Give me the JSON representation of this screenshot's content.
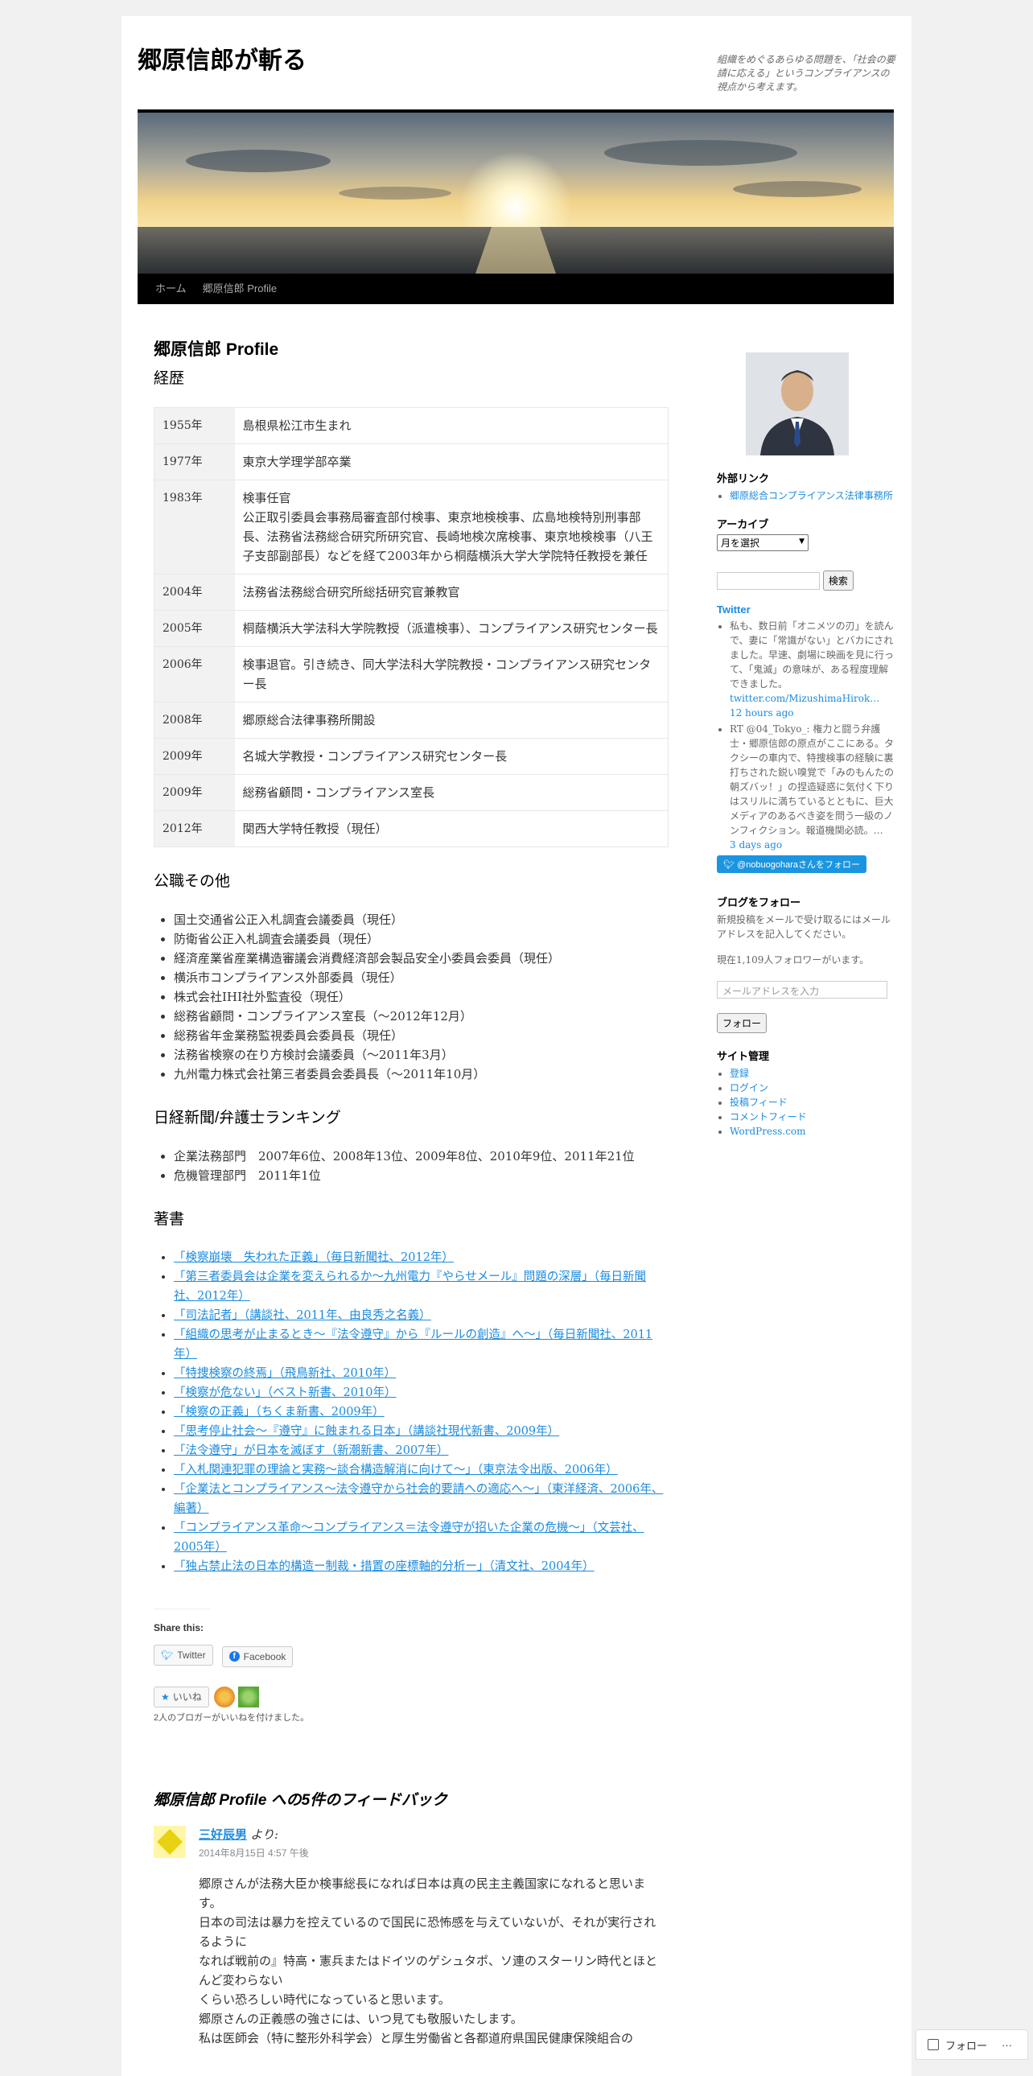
{
  "site": {
    "title": "郷原信郎が斬る",
    "description": "組織をめぐるあらゆる問題を、「社会の要請に応える」というコンプライアンスの視点から考えます。"
  },
  "nav": [
    "ホーム",
    "郷原信郎 Profile"
  ],
  "page": {
    "title": "郷原信郎 Profile",
    "career_heading": "経歴",
    "career": [
      {
        "year": "1955年",
        "text": "島根県松江市生まれ"
      },
      {
        "year": "1977年",
        "text": "東京大学理学部卒業"
      },
      {
        "year": "1983年",
        "text": "検事任官\n公正取引委員会事務局審査部付検事、東京地検検事、広島地検特別刑事部長、法務省法務総合研究所研究官、長崎地検次席検事、東京地検検事（八王子支部副部長）などを経て2003年から桐蔭横浜大学大学院特任教授を兼任"
      },
      {
        "year": "2004年",
        "text": "法務省法務総合研究所総括研究官兼教官"
      },
      {
        "year": "2005年",
        "text": "桐蔭横浜大学法科大学院教授（派遣検事）、コンプライアンス研究センター長"
      },
      {
        "year": "2006年",
        "text": "検事退官。引き続き、同大学法科大学院教授・コンプライアンス研究センター長"
      },
      {
        "year": "2008年",
        "text": "郷原総合法律事務所開設"
      },
      {
        "year": "2009年",
        "text": "名城大学教授・コンプライアンス研究センター長"
      },
      {
        "year": "2009年",
        "text": "総務省顧問・コンプライアンス室長"
      },
      {
        "year": "2012年",
        "text": "関西大学特任教授（現任）"
      }
    ],
    "public_heading": "公職その他",
    "public": [
      "国土交通省公正入札調査会議委員（現任）",
      "防衛省公正入札調査会議委員（現任）",
      "経済産業省産業構造審議会消費経済部会製品安全小委員会委員（現任）",
      "横浜市コンプライアンス外部委員（現任）",
      "株式会社IHI社外監査役（現任）",
      "総務省顧問・コンプライアンス室長（〜2012年12月）",
      "総務省年金業務監視委員会委員長（現任）",
      "法務省検察の在り方検討会議委員（〜2011年3月）",
      "九州電力株式会社第三者委員会委員長（〜2011年10月）"
    ],
    "ranking_heading": "日経新聞/弁護士ランキング",
    "ranking": [
      "企業法務部門　2007年6位、2008年13位、2009年8位、2010年9位、2011年21位",
      "危機管理部門　2011年1位"
    ],
    "books_heading": "著書",
    "books": [
      "「検察崩壊　失われた正義」（毎日新聞社、2012年）",
      "「第三者委員会は企業を変えられるか〜九州電力『やらせメール』問題の深層」（毎日新聞社、2012年）",
      "「司法記者」（講談社、2011年、由良秀之名義）",
      "「組織の思考が止まるとき〜『法令遵守』から『ルールの創造』へ〜」（毎日新聞社、2011年）",
      "「特捜検察の終焉」（飛鳥新社、2010年）",
      "「検察が危ない」（ベスト新書、2010年）",
      "「検察の正義」（ちくま新書、2009年）",
      "「思考停止社会〜『遵守』に蝕まれる日本」（講談社現代新書、2009年）",
      "「法令遵守」が日本を滅ぼす（新潮新書、2007年）",
      "「入札関連犯罪の理論と実務〜談合構造解消に向けて〜」（東京法令出版、2006年）",
      "「企業法とコンプライアンス〜法令遵守から社会的要請への適応へ〜」（東洋経済、2006年、編著）",
      "「コンプライアンス革命〜コンプライアンス＝法令遵守が招いた企業の危機〜」（文芸社、2005年）",
      "「独占禁止法の日本的構造ー制裁・措置の座標軸的分析ー」（清文社、2004年）"
    ],
    "share_title": "Share this:",
    "share_twitter": "Twitter",
    "share_facebook": "Facebook",
    "like_label": "いいね",
    "likers_text": "2人のブロガーがいいねを付けました。"
  },
  "comments": {
    "title": "郷原信郎 Profile への5件のフィードバック",
    "items": [
      {
        "author": "三好辰男",
        "says": "より:",
        "date": "2014年8月15日 4:57 午後",
        "body": [
          "郷原さんが法務大臣か検事総長になれば日本は真の民主主義国家になれると思います。",
          "日本の司法は暴力を控えているので国民に恐怖感を与えていないが、それが実行されるように",
          "なれば戦前の』特高・憲兵またはドイツのゲシュタポ、ソ連のスターリン時代とほとんど変わらない",
          "くらい恐ろしい時代になっていると思います。",
          "郷原さんの正義感の強さには、いつ見ても敬服いたします。",
          "私は医師会（特に整形外科学会）と厚生労働省と各都道府県国民健康保険組合の"
        ]
      }
    ]
  },
  "sidebar": {
    "external_links_title": "外部リンク",
    "external_links": [
      "郷原総合コンプライアンス法律事務所"
    ],
    "archive_title": "アーカイブ",
    "archive_select": "月を選択",
    "search_button": "検索",
    "twitter_title": "Twitter",
    "tweets": [
      {
        "text": "私も、数日前「オニメツの刃」を読んで、妻に「常識がない」とバカにされました。早速、劇場に映画を見に行って、「鬼滅」の意味が、ある程度理解できました。",
        "link": "twitter.com/MizushimaHirok…",
        "time": "12 hours ago"
      },
      {
        "text": "RT @04_Tokyo_: 権力と闘う弁護士・郷原信郎の原点がここにある。タクシーの車内で、特捜検事の経験に裏打ちされた鋭い嗅覚で「みのもんたの朝ズバッ！」の捏造疑惑に気付く下りはスリルに満ちているとともに、巨大メディアのあるべき姿を問う一級のノンフィクション。報道機関必読。…",
        "link": "",
        "time": "3 days ago"
      }
    ],
    "twitter_follow": "@nobuogoharaさんをフォロー",
    "blog_follow_title": "ブログをフォロー",
    "blog_follow_text": "新規投稿をメールで受け取るにはメールアドレスを記入してください。",
    "followers_text": "現在1,109人フォロワーがいます。",
    "email_placeholder": "メールアドレスを入力",
    "follow_button": "フォロー",
    "meta_title": "サイト管理",
    "meta_links": [
      "登録",
      "ログイン",
      "投稿フィード",
      "コメントフィード",
      "WordPress.com"
    ]
  },
  "floating_follow": "フォロー",
  "colors": {
    "link": "#1b8be0",
    "nav_bg": "#000000",
    "table_year_bg": "#f2f2f2"
  }
}
